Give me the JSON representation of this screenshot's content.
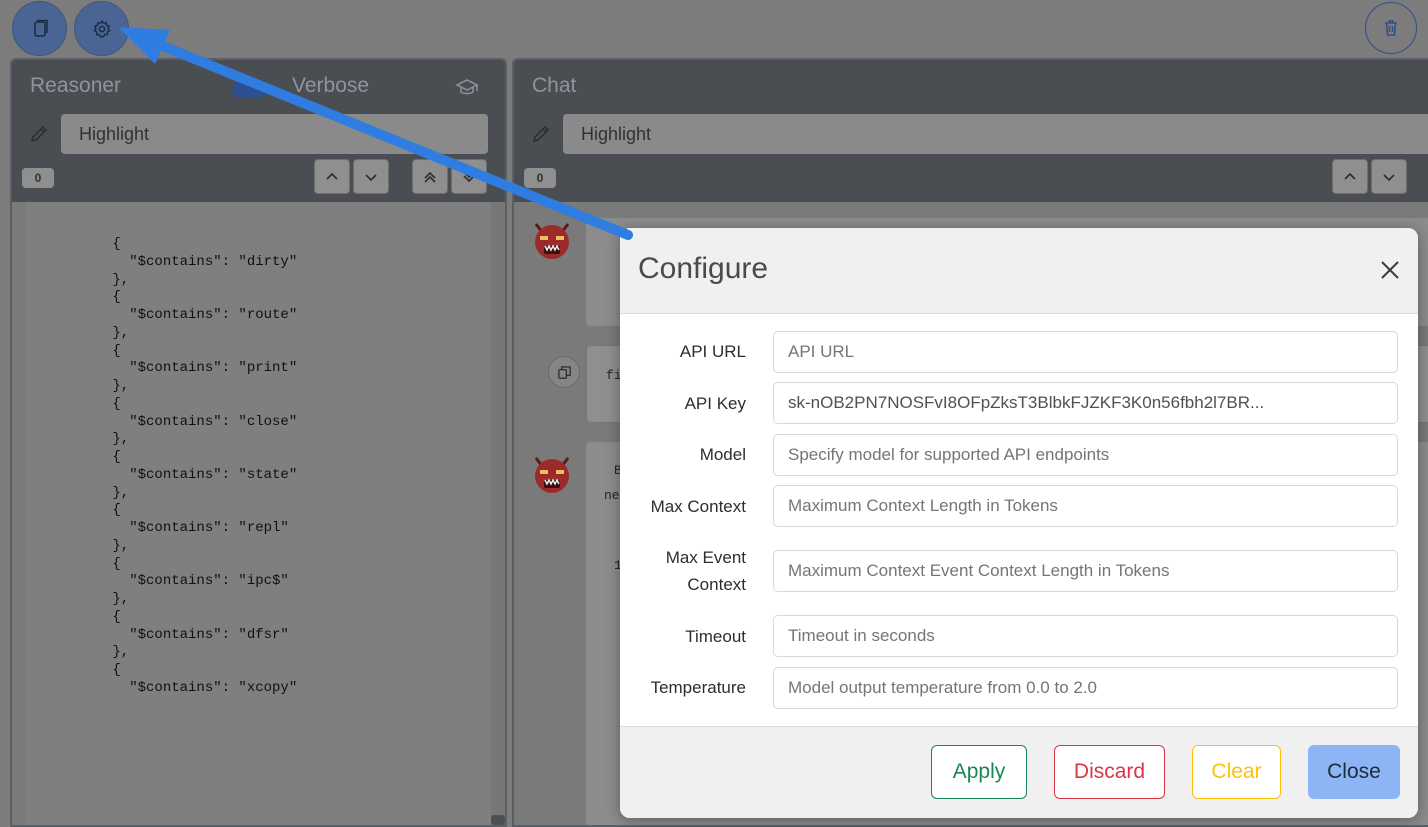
{
  "toolbar": {
    "copy_icon": "copy-icon",
    "settings_icon": "gear-icon",
    "trash_icon": "trash-icon"
  },
  "reasoner": {
    "title": "Reasoner",
    "verbose_label": "Verbose",
    "highlight_placeholder": "Highlight",
    "match_count": "0",
    "code_lines": [
      "      {",
      "        \"$contains\": \"dirty\"",
      "      },",
      "      {",
      "        \"$contains\": \"route\"",
      "      },",
      "      {",
      "        \"$contains\": \"print\"",
      "      },",
      "      {",
      "        \"$contains\": \"close\"",
      "      },",
      "      {",
      "        \"$contains\": \"state\"",
      "      },",
      "      {",
      "        \"$contains\": \"repl\"",
      "      },",
      "      {",
      "        \"$contains\": \"ipc$\"",
      "      },",
      "      {",
      "        \"$contains\": \"dfsr\"",
      "      },",
      "      {",
      "        \"$contains\": \"xcopy\""
    ]
  },
  "chat": {
    "title": "Chat",
    "highlight_placeholder": "Highlight",
    "match_count": "0",
    "fragments": [
      "fi",
      "B",
      "ne",
      "1"
    ]
  },
  "modal": {
    "title": "Configure",
    "fields": [
      {
        "label": "API URL",
        "value": "",
        "placeholder": "API URL"
      },
      {
        "label": "API Key",
        "value": "sk-nOB2PN7NOSFvI8OFpZksT3BlbkFJZKF3K0n56fbh2l7BR...",
        "placeholder": ""
      },
      {
        "label": "Model",
        "value": "",
        "placeholder": "Specify model for supported API endpoints"
      },
      {
        "label": "Max Context",
        "value": "",
        "placeholder": "Maximum Context Length in Tokens"
      },
      {
        "label_line1": "Max Event",
        "label_line2": "Context",
        "value": "",
        "placeholder": "Maximum Context Event Context Length in Tokens"
      },
      {
        "label": "Timeout",
        "value": "",
        "placeholder": "Timeout in seconds"
      },
      {
        "label": "Temperature",
        "value": "",
        "placeholder": "Model output temperature from 0.0 to 2.0"
      }
    ],
    "buttons": {
      "apply": "Apply",
      "discard": "Discard",
      "clear": "Clear",
      "close": "Close"
    }
  },
  "colors": {
    "apply": "#198754",
    "discard": "#dc3545",
    "clear": "#ffc107",
    "close_bg": "#8db4f5",
    "annotation_arrow": "#2f7de1"
  }
}
